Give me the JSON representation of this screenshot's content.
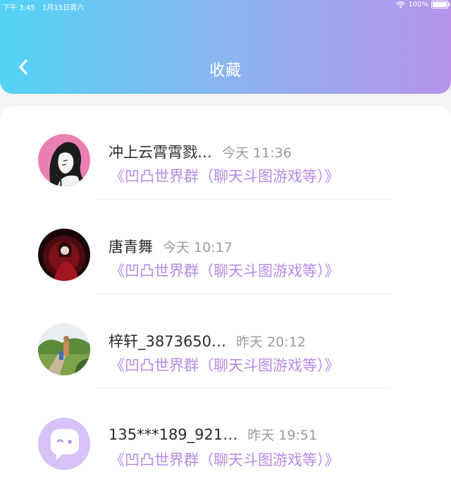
{
  "status_bar": {
    "time": "下午 3:45",
    "date": "1月15日周六",
    "battery": "100%"
  },
  "header": {
    "title": "收藏",
    "back_icon": "chevron-left-icon"
  },
  "favorites": [
    {
      "name": "冲上云霄霄戮…",
      "time": "今天 11:36",
      "group": "《凹凸世界群（聊天斗图游戏等）》",
      "avatar": "anime-avatar"
    },
    {
      "name": "唐青舞",
      "time": "今天 10:17",
      "group": "《凹凸世界群（聊天斗图游戏等）》",
      "avatar": "dark-red-avatar"
    },
    {
      "name": "梓轩_3873650…",
      "time": "昨天 20:12",
      "group": "《凹凸世界群（聊天斗图游戏等）》",
      "avatar": "photo-avatar"
    },
    {
      "name": "135***189_921…",
      "time": "昨天 19:51",
      "group": "《凹凸世界群（聊天斗图游戏等）》",
      "avatar": "default-chat-avatar"
    }
  ],
  "colors": {
    "gradient_start": "#52d3f6",
    "gradient_end": "#b794ea",
    "group_text": "#b58ae6",
    "default_avatar": "#d6c2f6"
  }
}
